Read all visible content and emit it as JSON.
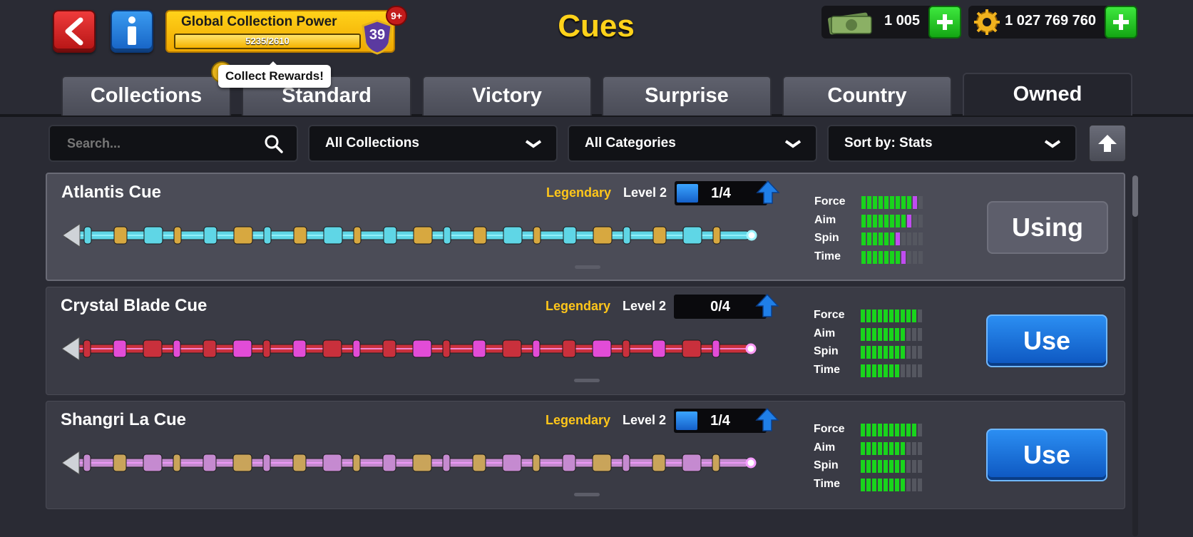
{
  "header": {
    "title": "Cues",
    "back_icon": "chevron-left-icon",
    "info_icon": "info-icon",
    "collection_power": {
      "label": "Global Collection Power",
      "progress_text": "5235/2610",
      "progress_fraction": 1.0,
      "level": "39",
      "notification": "9+"
    },
    "tooltip": "Collect Rewards!",
    "currencies": {
      "cash": "1 005",
      "coins": "1 027 769 760"
    }
  },
  "tabs": [
    {
      "label": "Collections",
      "active": false
    },
    {
      "label": "Standard",
      "active": false
    },
    {
      "label": "Victory",
      "active": false
    },
    {
      "label": "Surprise",
      "active": false
    },
    {
      "label": "Country",
      "active": false
    },
    {
      "label": "Owned",
      "active": true
    }
  ],
  "filters": {
    "search_placeholder": "Search...",
    "collections": "All Collections",
    "categories": "All Categories",
    "sort": "Sort by: Stats"
  },
  "stat_labels": [
    "Force",
    "Aim",
    "Spin",
    "Time"
  ],
  "cues": [
    {
      "name": "Atlantis Cue",
      "rarity": "Legendary",
      "level": "Level 2",
      "pieces": "1/4",
      "pieces_fraction": 0.25,
      "stats": {
        "force": [
          9,
          1
        ],
        "aim": [
          8,
          1
        ],
        "spin": [
          6,
          1
        ],
        "time": [
          7,
          1
        ]
      },
      "action": "Using",
      "state": "using",
      "colors": {
        "main": "#5fd6e6",
        "accent": "#d7a840",
        "glow": "#9ff6ff"
      }
    },
    {
      "name": "Crystal Blade Cue",
      "rarity": "Legendary",
      "level": "Level 2",
      "pieces": "0/4",
      "pieces_fraction": 0,
      "stats": {
        "force": [
          10,
          0
        ],
        "aim": [
          8,
          0
        ],
        "spin": [
          8,
          0
        ],
        "time": [
          7,
          0
        ]
      },
      "action": "Use",
      "state": "use",
      "colors": {
        "main": "#c9303c",
        "accent": "#e24cd7",
        "glow": "#ff9af7"
      }
    },
    {
      "name": "Shangri La Cue",
      "rarity": "Legendary",
      "level": "Level 2",
      "pieces": "1/4",
      "pieces_fraction": 0.25,
      "stats": {
        "force": [
          10,
          0
        ],
        "aim": [
          8,
          0
        ],
        "spin": [
          8,
          0
        ],
        "time": [
          8,
          0
        ]
      },
      "action": "Use",
      "state": "use",
      "colors": {
        "main": "#c58ad0",
        "accent": "#c9a45a",
        "glow": "#f59cff"
      }
    }
  ]
}
